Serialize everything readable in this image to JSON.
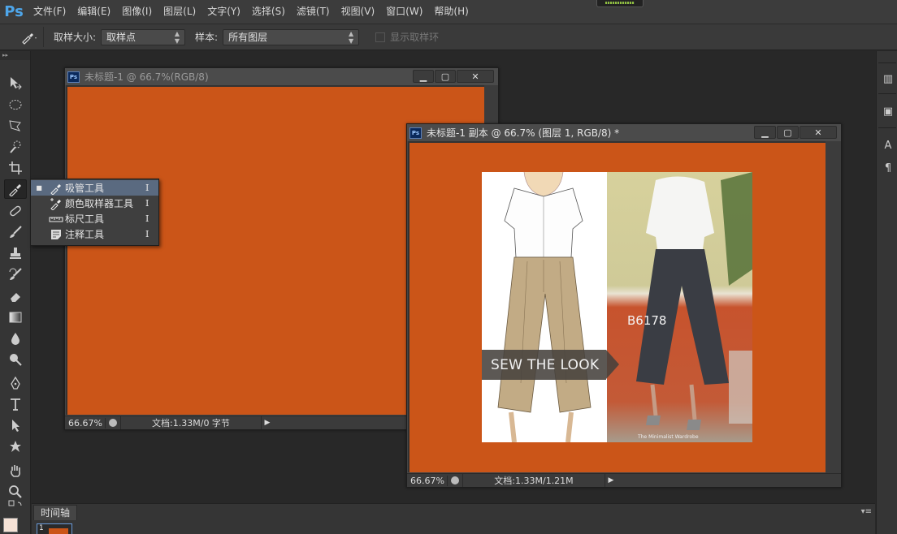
{
  "app": {
    "logo": "Ps",
    "menu": [
      "文件(F)",
      "编辑(E)",
      "图像(I)",
      "图层(L)",
      "文字(Y)",
      "选择(S)",
      "滤镜(T)",
      "视图(V)",
      "窗口(W)",
      "帮助(H)"
    ]
  },
  "options": {
    "sample_size_label": "取样大小:",
    "sample_size_value": "取样点",
    "sample_label": "样本:",
    "sample_value": "所有图层",
    "show_ring_label": "显示取样环"
  },
  "flyout": {
    "items": [
      {
        "label": "吸管工具",
        "shortcut": "I",
        "selected": true
      },
      {
        "label": "颜色取样器工具",
        "shortcut": "I",
        "selected": false
      },
      {
        "label": "标尺工具",
        "shortcut": "I",
        "selected": false
      },
      {
        "label": "注释工具",
        "shortcut": "I",
        "selected": false
      }
    ]
  },
  "doc1": {
    "title": "未标题-1 @ 66.7%(RGB/8)",
    "zoom": "66.67%",
    "doc_info": "文档:1.33M/0 字节"
  },
  "doc2": {
    "title": "未标题-1 副本 @ 66.7% (图层 1, RGB/8) *",
    "zoom": "66.67%",
    "doc_info": "文档:1.33M/1.21M",
    "image_banner": "SEW THE LOOK",
    "image_code": "B6178",
    "image_watermark": "The Minimalist Wardrobe"
  },
  "bottom": {
    "timeline_tab": "时间轴",
    "frame_number": "1"
  },
  "colors": {
    "canvas": "#cb5518",
    "foreground_swatch": "#f6e2d6",
    "ps_blue": "#4ea6ea"
  }
}
